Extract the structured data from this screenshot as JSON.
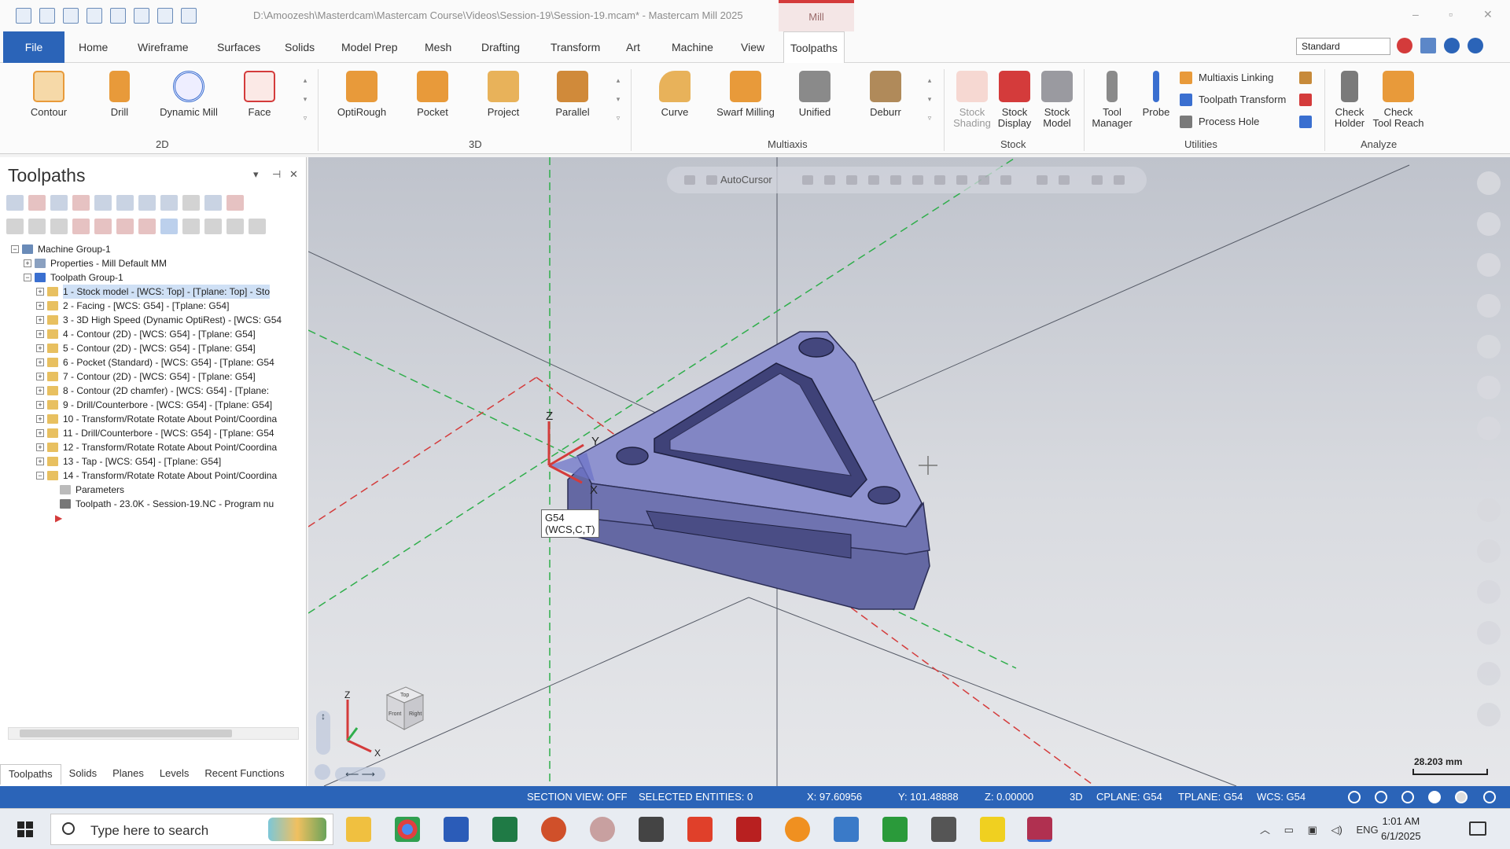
{
  "window": {
    "title": "D:\\Amoozesh\\Masterdcam\\Mastercam Course\\Videos\\Session-19\\Session-19.mcam* - Mastercam Mill 2025",
    "context_tab": "Mill",
    "controls": [
      "–",
      "▫",
      "✕"
    ]
  },
  "menu": {
    "file": "File",
    "items": [
      "Home",
      "Wireframe",
      "Surfaces",
      "Solids",
      "Model Prep",
      "Mesh",
      "Drafting",
      "Transform",
      "Art",
      "Machine",
      "View",
      "Toolpaths"
    ],
    "active": "Toolpaths",
    "standard_select": "Standard"
  },
  "ribbon": {
    "groups": [
      "2D",
      "3D",
      "Multiaxis",
      "Stock",
      "Utilities",
      "Analyze"
    ],
    "buttons_2d": [
      "Contour",
      "Drill",
      "Dynamic Mill",
      "Face"
    ],
    "buttons_3d": [
      "OptiRough",
      "Pocket",
      "Project",
      "Parallel"
    ],
    "buttons_multiaxis": [
      "Curve",
      "Swarf Milling",
      "Unified",
      "Deburr"
    ],
    "buttons_stock": [
      "Stock\nShading",
      "Stock\nDisplay",
      "Stock\nModel"
    ],
    "buttons_utilities": [
      "Tool\nManager",
      "Probe"
    ],
    "utilities_small": [
      "Multiaxis Linking",
      "Toolpath Transform",
      "Process Hole"
    ],
    "buttons_analyze": [
      "Check\nHolder",
      "Check\nTool Reach"
    ],
    "colors": {
      "orange": "#e89a3a",
      "blue": "#2b64b8",
      "red": "#d43b3b"
    }
  },
  "panel": {
    "title": "Toolpaths",
    "controls": [
      "▾",
      "⊣",
      "✕"
    ],
    "tree": [
      "Machine Group-1",
      "Properties - Mill Default MM",
      "Toolpath Group-1",
      "1 - Stock model - [WCS: Top] - [Tplane: Top] - Sto",
      "2 - Facing - [WCS: G54] - [Tplane: G54]",
      "3 - 3D High Speed (Dynamic OptiRest) - [WCS: G54",
      "4 - Contour (2D) - [WCS: G54] - [Tplane: G54]",
      "5 - Contour (2D) - [WCS: G54] - [Tplane: G54]",
      "6 - Pocket (Standard) - [WCS: G54] - [Tplane: G54",
      "7 - Contour (2D) - [WCS: G54] - [Tplane: G54]",
      "8 - Contour (2D chamfer) - [WCS: G54] - [Tplane:",
      "9 - Drill/Counterbore - [WCS: G54] - [Tplane: G54]",
      "10 - Transform/Rotate Rotate About Point/Coordina",
      "11 - Drill/Counterbore - [WCS: G54] - [Tplane: G54",
      "12 - Transform/Rotate Rotate About Point/Coordina",
      "13 - Tap - [WCS: G54] - [Tplane: G54]",
      "14 - Transform/Rotate Rotate About Point/Coordina",
      "Parameters",
      "Toolpath - 23.0K - Session-19.NC - Program nu"
    ],
    "tabs": [
      "Toolpaths",
      "Solids",
      "Planes",
      "Levels",
      "Recent Functions"
    ]
  },
  "viewport": {
    "autocursor": "AutoCursor",
    "axis_labels": {
      "z": "Z",
      "y": "Y",
      "x": "X"
    },
    "wcs_tooltip": "G54\n(WCS,C,T)",
    "scale": "28.203 mm",
    "cube_faces": [
      "Top",
      "Front",
      "Right"
    ],
    "nav_arrows": "⟵ ⟶",
    "nav_vert": "↕",
    "model_color": "#7d80b8"
  },
  "status": {
    "section_view": "SECTION VIEW: OFF",
    "selected": "SELECTED ENTITIES: 0",
    "x": "X:  97.60956",
    "y": "Y:  101.48888",
    "z": "Z:  0.00000",
    "mode": "3D",
    "cplane": "CPLANE: G54",
    "tplane": "TPLANE: G54",
    "wcs": "WCS: G54"
  },
  "taskbar": {
    "search_placeholder": "Type here to search",
    "tray_lang": "ENG",
    "time": "1:01 AM",
    "date": "6/1/2025"
  }
}
